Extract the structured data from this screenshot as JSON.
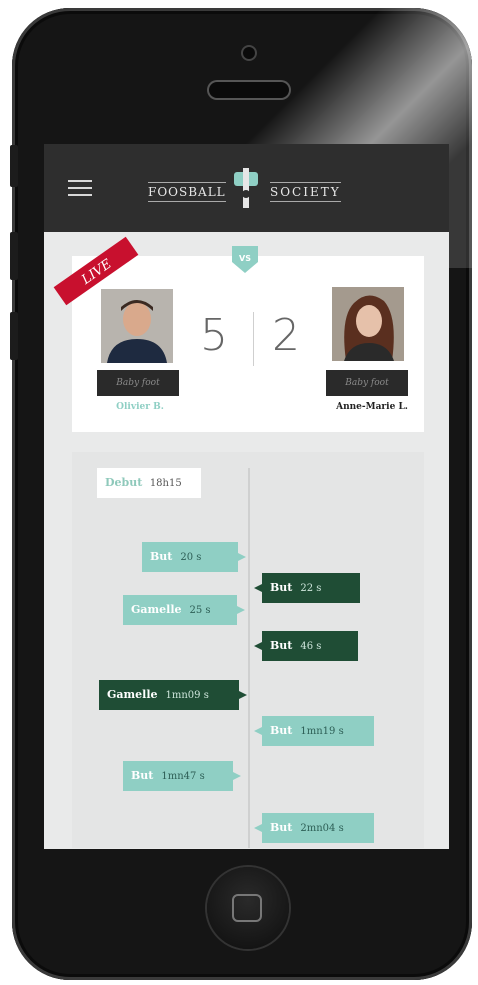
{
  "app": {
    "brand_left": "FOOSBALL",
    "brand_right": "SOCIETY"
  },
  "match": {
    "live_label": "LIVE",
    "vs_label": "VS",
    "player_left": {
      "name": "Olivier B.",
      "plate": "Baby foot",
      "score": "5"
    },
    "player_right": {
      "name": "Anne-Marie L.",
      "plate": "Baby foot",
      "score": "2"
    }
  },
  "timeline": {
    "start": {
      "label": "Debut",
      "time": "18h15"
    },
    "events": [
      {
        "side": "left",
        "style": "light",
        "label": "But",
        "time": "20 s"
      },
      {
        "side": "right",
        "style": "dark",
        "label": "But",
        "time": "22 s"
      },
      {
        "side": "left",
        "style": "light",
        "label": "Gamelle",
        "time": "25 s"
      },
      {
        "side": "right",
        "style": "dark",
        "label": "But",
        "time": "46 s"
      },
      {
        "side": "left",
        "style": "dark",
        "label": "Gamelle",
        "time": "1mn09 s"
      },
      {
        "side": "right",
        "style": "light",
        "label": "But",
        "time": "1mn19 s"
      },
      {
        "side": "left",
        "style": "light",
        "label": "But",
        "time": "1mn47 s"
      },
      {
        "side": "right",
        "style": "light",
        "label": "But",
        "time": "2mn04 s"
      }
    ]
  },
  "colors": {
    "accent_light": "#8fcfc4",
    "accent_dark": "#1f4d35",
    "nav_bg": "#2e2e2e",
    "live_ribbon": "#c8102e"
  }
}
